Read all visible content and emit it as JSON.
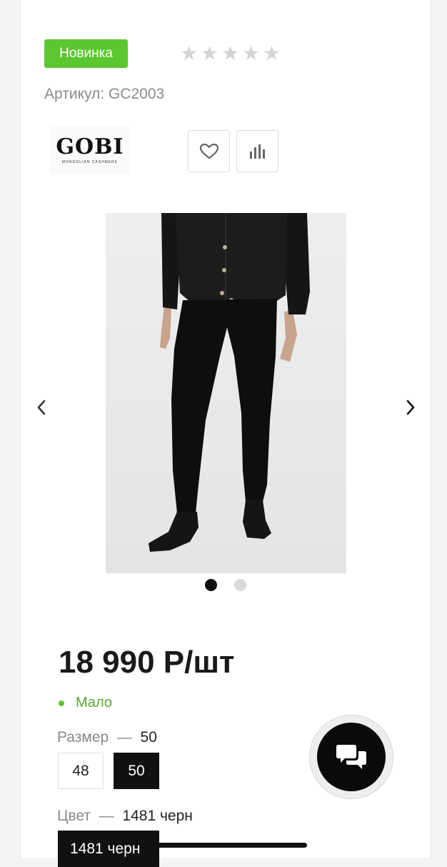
{
  "product": {
    "badge": "Новинка",
    "rating": {
      "filled": 0,
      "max": 5
    },
    "sku": "Артикул: GC2003",
    "brand": {
      "name": "GOBI",
      "tagline": "MONGOLIAN CASHMERE"
    },
    "actions": {
      "favorite_icon": "heart-icon",
      "compare_icon": "bar-chart-icon"
    },
    "gallery": {
      "current": 1,
      "total": 2
    },
    "price": "18 990 Р/шт",
    "stock": "Мало",
    "size": {
      "label": "Размер",
      "separator": "—",
      "selected": "50",
      "options": [
        "48",
        "50"
      ]
    },
    "color": {
      "label": "Цвет",
      "separator": "—",
      "selected": "1481 черн",
      "options": [
        "1481 черн"
      ]
    }
  },
  "colors": {
    "accent_green": "#5cc62f",
    "selected_bg": "#111111"
  },
  "chat": {
    "icon": "chat-bubbles-icon"
  }
}
